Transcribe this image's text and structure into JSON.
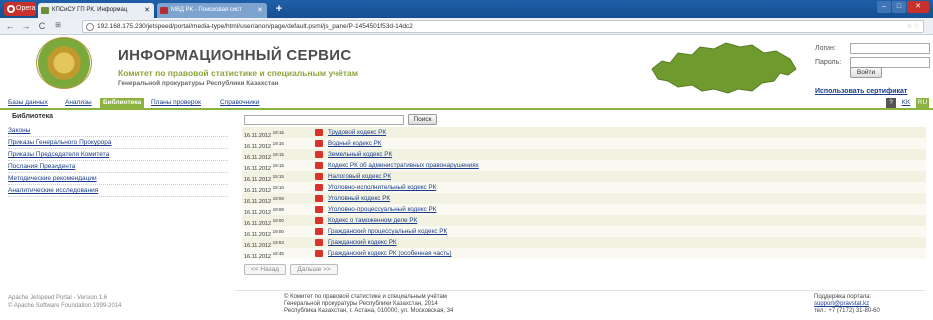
{
  "browser": {
    "opera_label": "Opera",
    "tabs": [
      {
        "label": "КПСиСУ ГП РК. Информац"
      },
      {
        "label": "МВД РК - Поисковая сист"
      }
    ],
    "url": "192.168.175.230/jetspeed/portal/media-type/html/user/anon/page/default.psml/js_pane/P-1454501f53d-14dc2"
  },
  "header": {
    "title": "ИНФОРМАЦИОННЫЙ СЕРВИС",
    "subtitle": "Комитет по правовой статистике и специальным учётам",
    "subtitle2": "Генеральной прокуратуры Республики Казахстан"
  },
  "login": {
    "login_label": "Логин:",
    "password_label": "Пароль:",
    "submit_label": "Войти",
    "cert_link": "Использовать сертификат"
  },
  "nav": {
    "items": [
      {
        "label": "Базы данных"
      },
      {
        "label": "Анализы"
      },
      {
        "label": "Библиотека"
      },
      {
        "label": "Планы проверок"
      },
      {
        "label": "Справочники"
      }
    ],
    "langs": [
      "?",
      "KK",
      "RU"
    ]
  },
  "sidebar": {
    "heading": "Библиотека",
    "items": [
      {
        "label": "Законы"
      },
      {
        "label": "Приказы Генерального Прокурора"
      },
      {
        "label": "Приказы Председателя Комитета"
      },
      {
        "label": "Послания Президента"
      },
      {
        "label": "Методические рекомендации"
      },
      {
        "label": "Аналитические исследования"
      }
    ]
  },
  "library": {
    "search_label": "Поиск",
    "rows": [
      {
        "date": "16.11.2012",
        "time": "19:15",
        "title": "Трудовой кодекс РК"
      },
      {
        "date": "16.11.2012",
        "time": "19:15",
        "title": "Водный кодекс РК"
      },
      {
        "date": "16.11.2012",
        "time": "19:15",
        "title": "Земельный кодекс РК"
      },
      {
        "date": "16.11.2012",
        "time": "19:15",
        "title": "Кодекс РК об административных правонарушениях"
      },
      {
        "date": "16.11.2012",
        "time": "19:15",
        "title": "Налоговый кодекс РК"
      },
      {
        "date": "16.11.2012",
        "time": "19:10",
        "title": "Уголовно-исполнительный кодекс РК"
      },
      {
        "date": "16.11.2012",
        "time": "19:09",
        "title": "Уголовный кодекс РК"
      },
      {
        "date": "16.11.2012",
        "time": "19:08",
        "title": "Уголовно-процессуальный кодекс РК"
      },
      {
        "date": "16.11.2012",
        "time": "19:00",
        "title": "Кодекс о таможенном деле РК"
      },
      {
        "date": "16.11.2012",
        "time": "19:00",
        "title": "Гражданский процессуальный кодекс РК"
      },
      {
        "date": "16.11.2012",
        "time": "18:53",
        "title": "Гражданский кодекс РК"
      },
      {
        "date": "16.11.2012",
        "time": "18:45",
        "title": "Гражданский кодекс РК (особенная часть)"
      }
    ],
    "prev_label": "<< Назад",
    "next_label": "Дальше >>"
  },
  "footer": {
    "left1": "Apache Jetspeed Portal - Version 1.6",
    "left2": "© Apache Software Foundation 1999-2014",
    "center1": "© Комитет по правовой статистике и специальным учётам",
    "center2": "Генеральной прокуратуры Республики Казахстан, 2014",
    "center3": "Республика Казахстан, г. Астана, 010000, ул. Московская, 34",
    "support_label": "Поддержка портала:",
    "support_email": "support@pravstat.kz",
    "support_phone": "тел.: +7 (7172) 31-80-60"
  },
  "colors": {
    "accent": "#8cb23f",
    "link": "#1a3d8a",
    "browser_chrome": "#1f5fa8"
  }
}
